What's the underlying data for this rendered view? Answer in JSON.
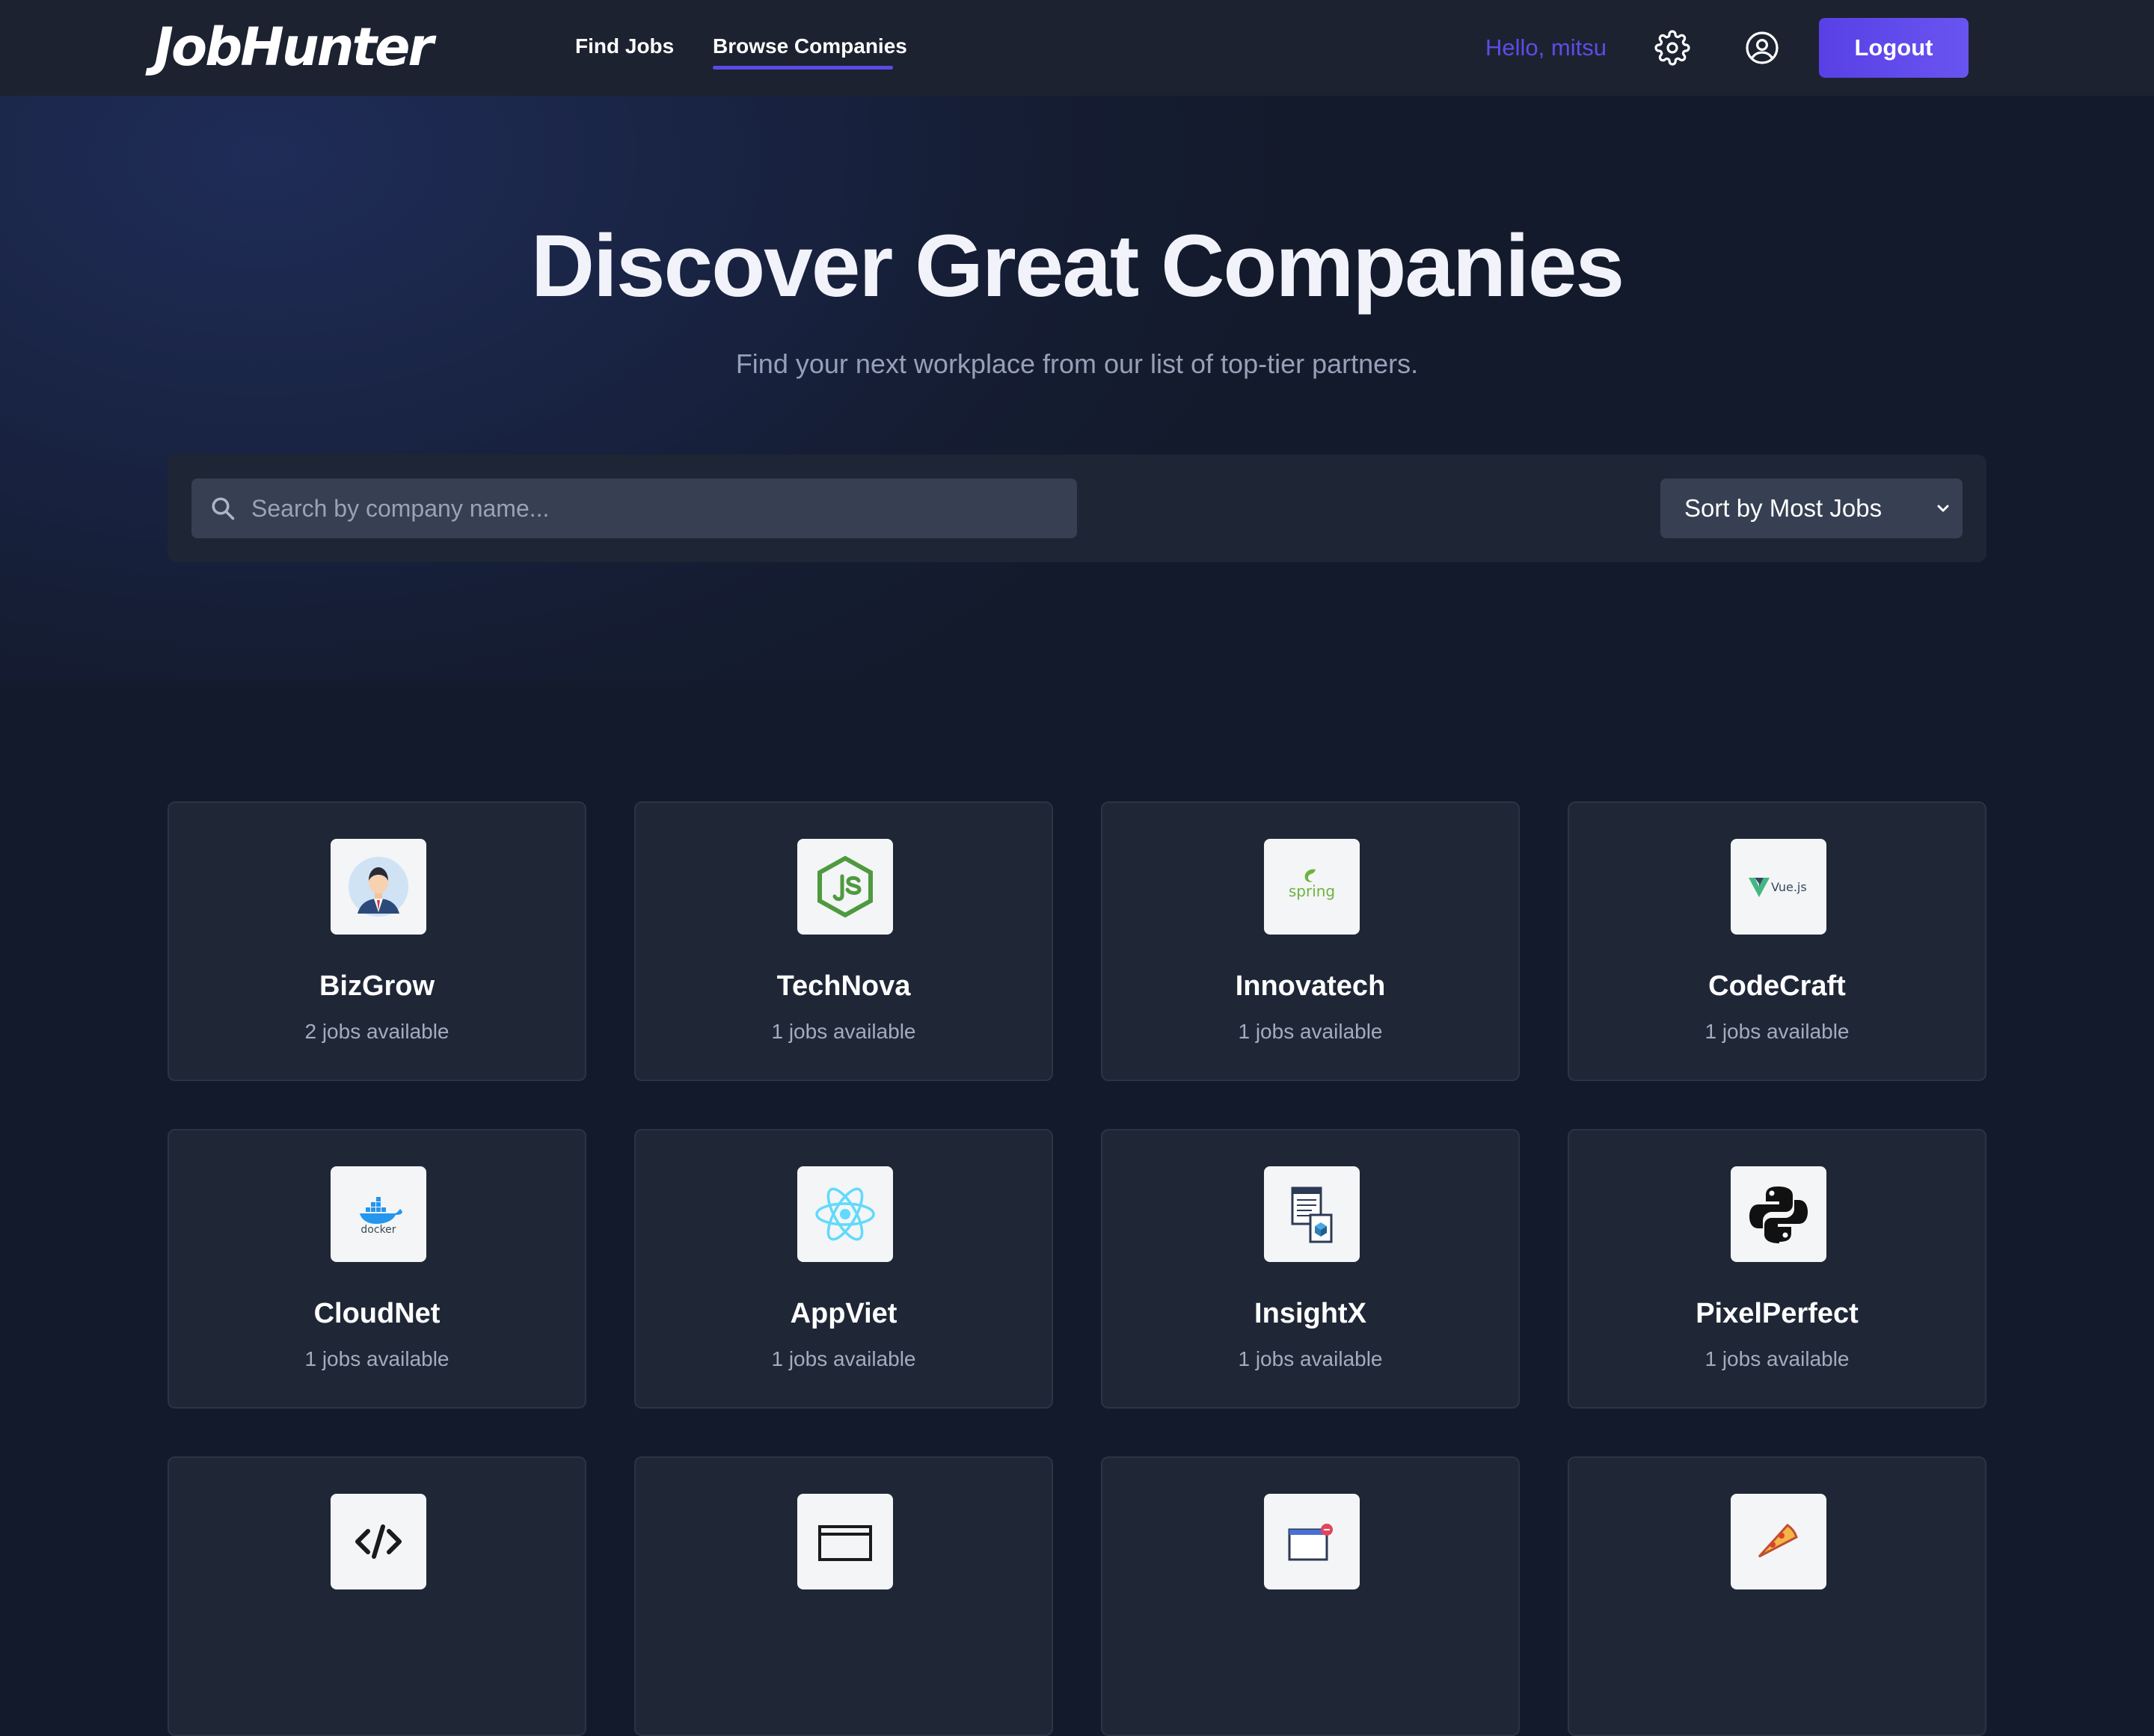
{
  "nav": {
    "logo": "JobHunter",
    "links": [
      {
        "label": "Find Jobs"
      },
      {
        "label": "Browse Companies",
        "active": true
      }
    ],
    "greeting": "Hello, mitsu",
    "settings_icon": "gear-icon",
    "profile_icon": "user-circle-icon",
    "logout_label": "Logout"
  },
  "hero": {
    "title": "Discover Great Companies",
    "subtitle": "Find your next workplace from our list of top-tier partners."
  },
  "filters": {
    "search_placeholder": "Search by company name...",
    "search_value": "",
    "sort_selected": "Sort by Most Jobs"
  },
  "colors": {
    "accent": "#5a4ee8",
    "nav_bg": "#1d2230",
    "card_bg": "#1f2737",
    "page_bg": "#131a2b"
  },
  "companies": [
    {
      "name": "BizGrow",
      "jobs": "2 jobs available",
      "logo": "businessman-avatar"
    },
    {
      "name": "TechNova",
      "jobs": "1 jobs available",
      "logo": "nodejs-logo"
    },
    {
      "name": "Innovatech",
      "jobs": "1 jobs available",
      "logo": "spring-logo",
      "logo_text": "spring"
    },
    {
      "name": "CodeCraft",
      "jobs": "1 jobs available",
      "logo": "vuejs-logo",
      "logo_text": "Vue.js"
    },
    {
      "name": "CloudNet",
      "jobs": "1 jobs available",
      "logo": "docker-logo",
      "logo_text": "docker"
    },
    {
      "name": "AppViet",
      "jobs": "1 jobs available",
      "logo": "react-logo"
    },
    {
      "name": "InsightX",
      "jobs": "1 jobs available",
      "logo": "documents-cube-logo"
    },
    {
      "name": "PixelPerfect",
      "jobs": "1 jobs available",
      "logo": "python-logo"
    },
    {
      "logo": "code-brackets-logo"
    },
    {
      "logo": "window-logo"
    },
    {
      "logo": "browser-bug-logo"
    },
    {
      "logo": "pizza-logo"
    }
  ]
}
